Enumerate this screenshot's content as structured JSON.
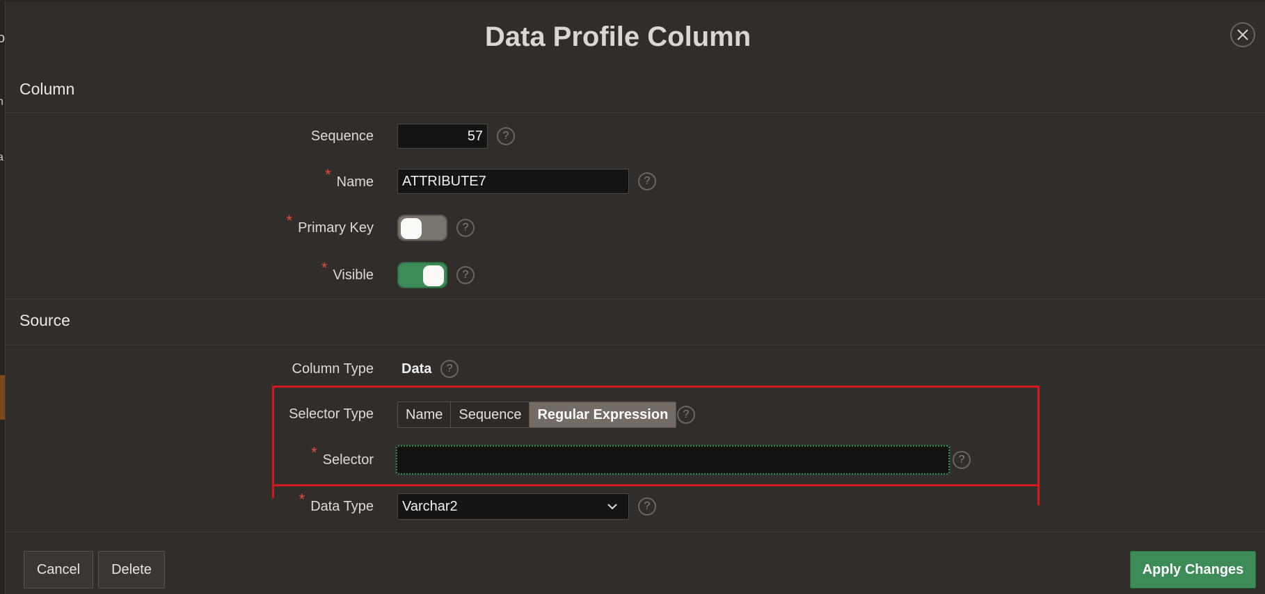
{
  "background": {
    "fragments": [
      "o",
      "h",
      "a"
    ]
  },
  "dialog": {
    "title": "Data Profile Column",
    "close_icon": "close-icon"
  },
  "sections": {
    "column": "Column",
    "source": "Source"
  },
  "fields": {
    "sequence": {
      "label": "Sequence",
      "value": "57"
    },
    "name": {
      "label": "Name",
      "value": "ATTRIBUTE7",
      "required": "*"
    },
    "primary_key": {
      "label": "Primary Key",
      "required": "*",
      "state": "off"
    },
    "visible": {
      "label": "Visible",
      "required": "*",
      "state": "on"
    },
    "column_type": {
      "label": "Column Type",
      "value": "Data"
    },
    "selector_type": {
      "label": "Selector Type",
      "options": [
        "Name",
        "Sequence",
        "Regular Expression"
      ],
      "selected": "Regular Expression"
    },
    "selector": {
      "label": "Selector",
      "required": "*",
      "value": ""
    },
    "data_type": {
      "label": "Data Type",
      "required": "*",
      "value": "Varchar2"
    }
  },
  "help_glyph": "?",
  "buttons": {
    "cancel": "Cancel",
    "delete": "Delete",
    "apply": "Apply Changes"
  },
  "colors": {
    "accent_green": "#3d8b57",
    "required_red": "#e2503a",
    "annotation_red": "#d2181d"
  }
}
